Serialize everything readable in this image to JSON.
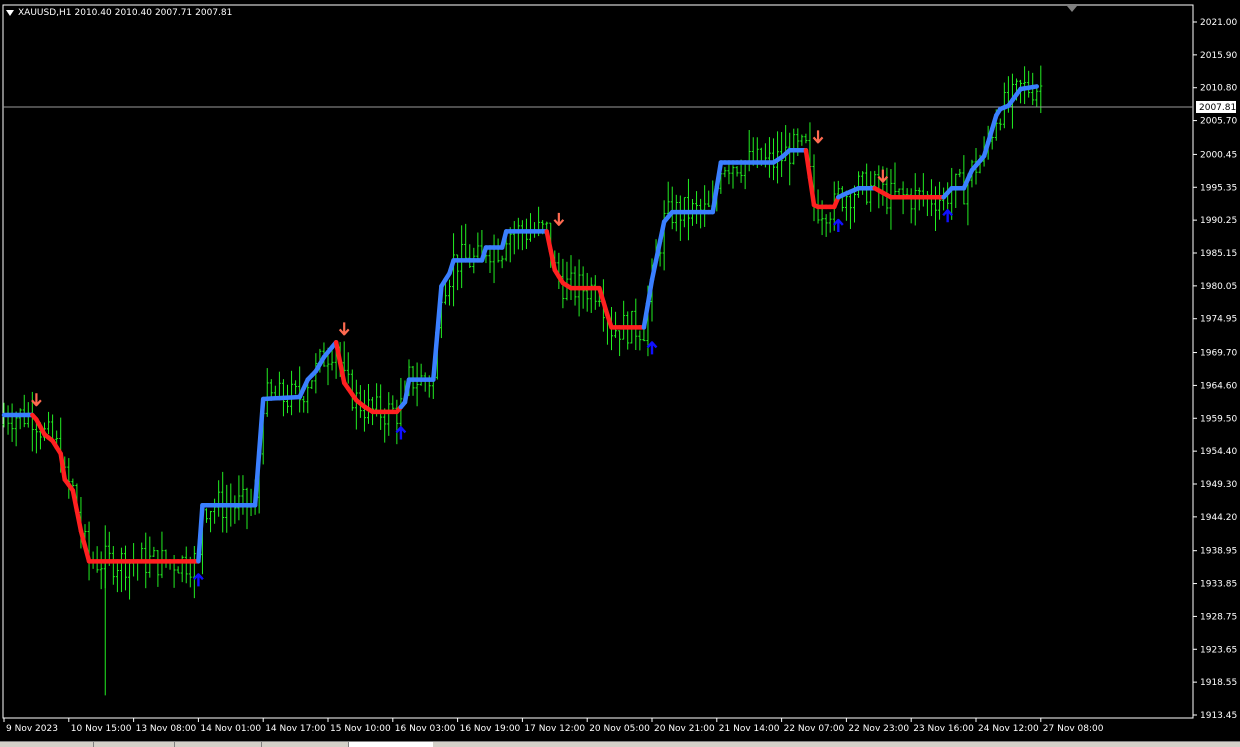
{
  "window": {
    "symbol": "XAUUSD,H1",
    "ohlc": [
      "2010.40",
      "2010.40",
      "2007.71",
      "2007.81"
    ]
  },
  "colors": {
    "background": "#000000",
    "candles": "#22ee22",
    "uptrend_line": "#3a7fff",
    "downtrend_line": "#ff2020",
    "buy_arrow": "#1010ff",
    "sell_arrow": "#ff6a50",
    "axis": "#ffffff",
    "bid_line": "#9a9a9a"
  },
  "chart_data": {
    "type": "line",
    "instrument": "XAUUSD",
    "timeframe": "H1",
    "current_price": "2007.81",
    "ylim": [
      1913.45,
      2021.0
    ],
    "y_ticks": [
      "2021.00",
      "2015.90",
      "2010.80",
      "2005.70",
      "2000.45",
      "1995.35",
      "1990.25",
      "1985.15",
      "1980.05",
      "1974.95",
      "1969.70",
      "1964.60",
      "1959.50",
      "1954.40",
      "1949.30",
      "1944.20",
      "1938.95",
      "1933.85",
      "1928.75",
      "1923.65",
      "1918.55",
      "1913.45"
    ],
    "x_ticks": [
      "9 Nov 2023",
      "10 Nov 15:00",
      "13 Nov 08:00",
      "14 Nov 01:00",
      "14 Nov 17:00",
      "15 Nov 10:00",
      "16 Nov 03:00",
      "16 Nov 19:00",
      "17 Nov 12:00",
      "20 Nov 05:00",
      "20 Nov 21:00",
      "21 Nov 14:00",
      "22 Nov 07:00",
      "22 Nov 23:00",
      "23 Nov 16:00",
      "24 Nov 12:00",
      "27 Nov 08:00"
    ],
    "x_tick_index": [
      0,
      16,
      32,
      48,
      64,
      80,
      96,
      112,
      128,
      144,
      160,
      176,
      192,
      208,
      224,
      240,
      256
    ],
    "trend_line": [
      {
        "i": 0,
        "p": 1960.0
      },
      {
        "i": 7,
        "p": 1960.0
      },
      {
        "i": 8,
        "p": 1959.3
      },
      {
        "i": 10,
        "p": 1957.0
      },
      {
        "i": 12,
        "p": 1956.0
      },
      {
        "i": 14,
        "p": 1954.0
      },
      {
        "i": 15,
        "p": 1950.0
      },
      {
        "i": 17,
        "p": 1948.3
      },
      {
        "i": 19,
        "p": 1942.0
      },
      {
        "i": 21,
        "p": 1937.3
      },
      {
        "i": 48,
        "p": 1937.3
      },
      {
        "i": 49,
        "p": 1946.0
      },
      {
        "i": 62,
        "p": 1946.0
      },
      {
        "i": 64,
        "p": 1962.5
      },
      {
        "i": 73,
        "p": 1962.8
      },
      {
        "i": 75,
        "p": 1965.5
      },
      {
        "i": 77,
        "p": 1966.8
      },
      {
        "i": 79,
        "p": 1969.0
      },
      {
        "i": 82,
        "p": 1971.3
      },
      {
        "i": 84,
        "p": 1965.0
      },
      {
        "i": 87,
        "p": 1962.3
      },
      {
        "i": 89,
        "p": 1961.3
      },
      {
        "i": 91,
        "p": 1960.5
      },
      {
        "i": 97,
        "p": 1960.5
      },
      {
        "i": 99,
        "p": 1962.0
      },
      {
        "i": 100,
        "p": 1965.5
      },
      {
        "i": 106,
        "p": 1965.5
      },
      {
        "i": 108,
        "p": 1980.0
      },
      {
        "i": 110,
        "p": 1982.0
      },
      {
        "i": 111,
        "p": 1984.0
      },
      {
        "i": 118,
        "p": 1984.0
      },
      {
        "i": 119,
        "p": 1986.0
      },
      {
        "i": 123,
        "p": 1986.0
      },
      {
        "i": 124,
        "p": 1988.5
      },
      {
        "i": 134,
        "p": 1988.5
      },
      {
        "i": 136,
        "p": 1982.5
      },
      {
        "i": 138,
        "p": 1980.5
      },
      {
        "i": 140,
        "p": 1979.7
      },
      {
        "i": 147,
        "p": 1979.7
      },
      {
        "i": 149,
        "p": 1975.5
      },
      {
        "i": 150,
        "p": 1973.6
      },
      {
        "i": 158,
        "p": 1973.6
      },
      {
        "i": 160,
        "p": 1981.0
      },
      {
        "i": 163,
        "p": 1990.0
      },
      {
        "i": 165,
        "p": 1991.5
      },
      {
        "i": 175,
        "p": 1991.5
      },
      {
        "i": 177,
        "p": 1999.2
      },
      {
        "i": 190,
        "p": 1999.2
      },
      {
        "i": 192,
        "p": 2000.0
      },
      {
        "i": 194,
        "p": 2001.1
      },
      {
        "i": 198,
        "p": 2001.1
      },
      {
        "i": 200,
        "p": 1992.6
      },
      {
        "i": 201,
        "p": 1992.3
      },
      {
        "i": 205,
        "p": 1992.3
      },
      {
        "i": 206,
        "p": 1993.8
      },
      {
        "i": 208,
        "p": 1994.4
      },
      {
        "i": 211,
        "p": 1995.2
      },
      {
        "i": 215,
        "p": 1995.2
      },
      {
        "i": 217,
        "p": 1994.5
      },
      {
        "i": 219,
        "p": 1993.8
      },
      {
        "i": 232,
        "p": 1993.8
      },
      {
        "i": 234,
        "p": 1995.2
      },
      {
        "i": 237,
        "p": 1995.2
      },
      {
        "i": 239,
        "p": 1998.0
      },
      {
        "i": 242,
        "p": 2000.2
      },
      {
        "i": 245,
        "p": 2006.5
      },
      {
        "i": 246,
        "p": 2007.5
      },
      {
        "i": 248,
        "p": 2008.0
      },
      {
        "i": 251,
        "p": 2010.6
      },
      {
        "i": 255,
        "p": 2011.0
      }
    ],
    "down_segments": [
      [
        7,
        48
      ],
      [
        82,
        98
      ],
      [
        134,
        158
      ],
      [
        198,
        206
      ],
      [
        215,
        232
      ]
    ],
    "sell_arrows": [
      {
        "i": 8,
        "p": 1962.3
      },
      {
        "i": 84,
        "p": 1973.3
      },
      {
        "i": 137,
        "p": 1990.3
      },
      {
        "i": 201,
        "p": 2003.1
      },
      {
        "i": 217,
        "p": 1997.0
      }
    ],
    "buy_arrows": [
      {
        "i": 48,
        "p": 1934.5
      },
      {
        "i": 98,
        "p": 1957.3
      },
      {
        "i": 160,
        "p": 1970.5
      },
      {
        "i": 206,
        "p": 1989.5
      },
      {
        "i": 233,
        "p": 1991.0
      }
    ]
  }
}
